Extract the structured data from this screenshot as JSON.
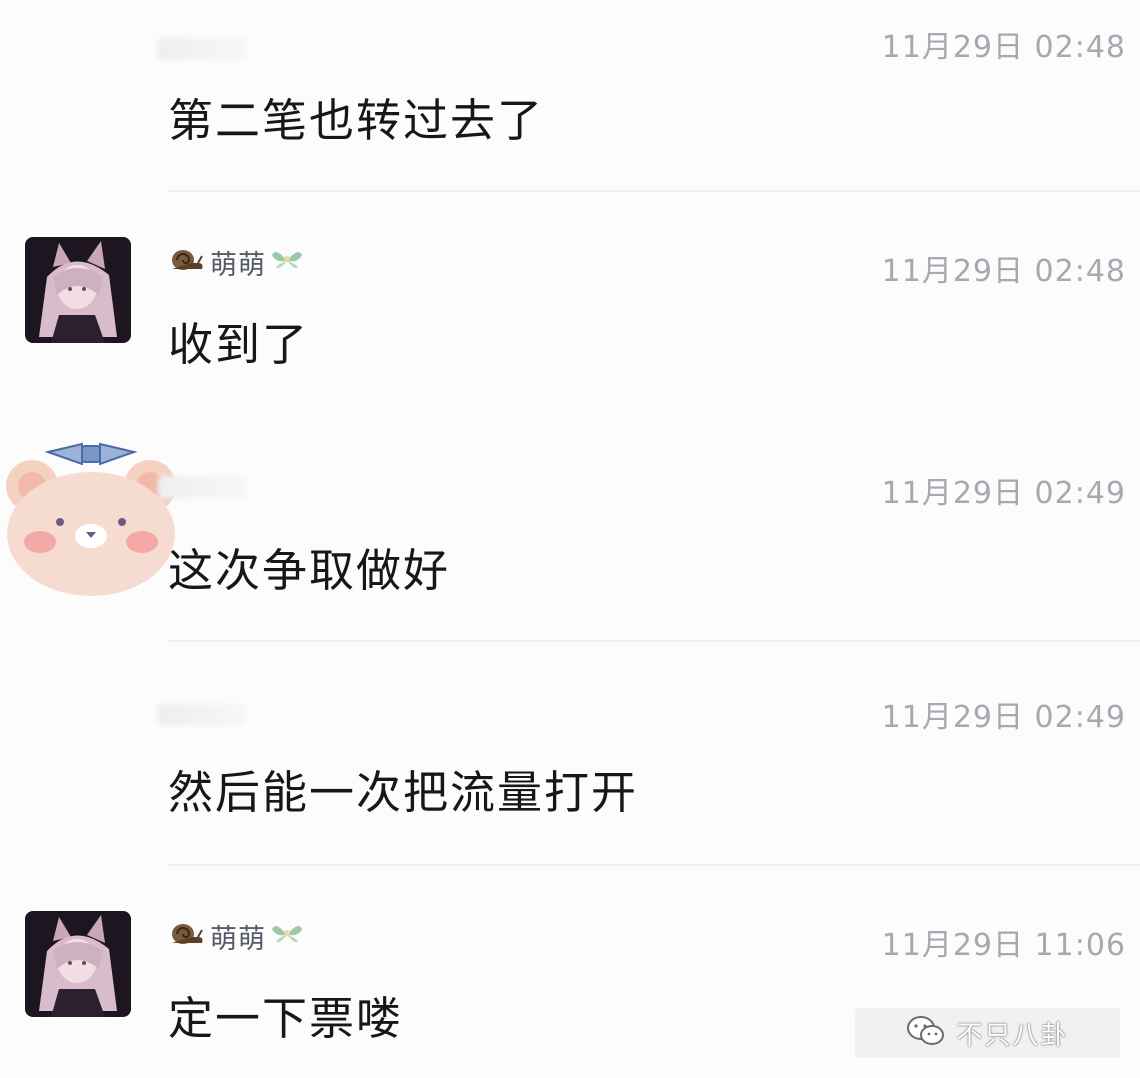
{
  "messages": [
    {
      "sender": "",
      "time": "11月29日 02:48",
      "text": "第二笔也转过去了"
    },
    {
      "sender": "萌萌",
      "time": "11月29日 02:48",
      "text": "收到了"
    },
    {
      "sender": "",
      "time": "11月29日 02:49",
      "text": "这次争取做好"
    },
    {
      "sender": "",
      "time": "11月29日 02:49",
      "text": "然后能一次把流量打开"
    },
    {
      "sender": "萌萌",
      "time": "11月29日 11:06",
      "text": "定一下票喽"
    }
  ],
  "icons": {
    "sender_prefix": "snail-icon",
    "sender_suffix": "fairy-icon",
    "watermark": "wechat-logo-icon"
  },
  "watermark": {
    "text": "不只八卦"
  },
  "colors": {
    "text": "#16171a",
    "time": "#a6a9b0",
    "divider": "#eeeff2"
  }
}
